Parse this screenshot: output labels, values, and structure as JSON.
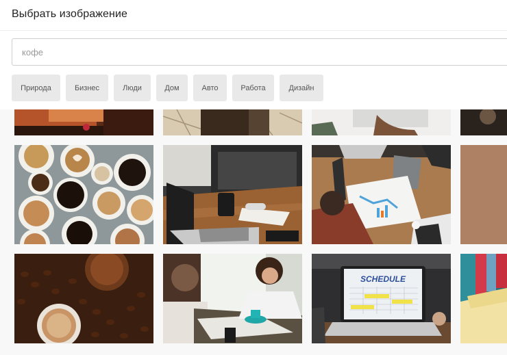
{
  "dialog": {
    "title": "Выбрать изображение"
  },
  "search": {
    "value": "",
    "placeholder": "кофе"
  },
  "categories": [
    "Природа",
    "Бизнес",
    "Люди",
    "Дом",
    "Авто",
    "Работа",
    "Дизайн"
  ],
  "images": [
    {
      "name": "image-coffee-candle"
    },
    {
      "name": "image-maps-notebook"
    },
    {
      "name": "image-hands-laptop"
    },
    {
      "name": "image-cafe-partial"
    },
    {
      "name": "image-coffee-cups-overhead"
    },
    {
      "name": "image-laptop-desk-coffee"
    },
    {
      "name": "image-business-meeting-charts"
    },
    {
      "name": "image-brown-partial"
    },
    {
      "name": "image-coffee-beans-cup"
    },
    {
      "name": "image-people-cafe"
    },
    {
      "name": "image-laptop-schedule"
    },
    {
      "name": "image-binders-folders"
    }
  ],
  "schedule_text": "SCHEDULE"
}
